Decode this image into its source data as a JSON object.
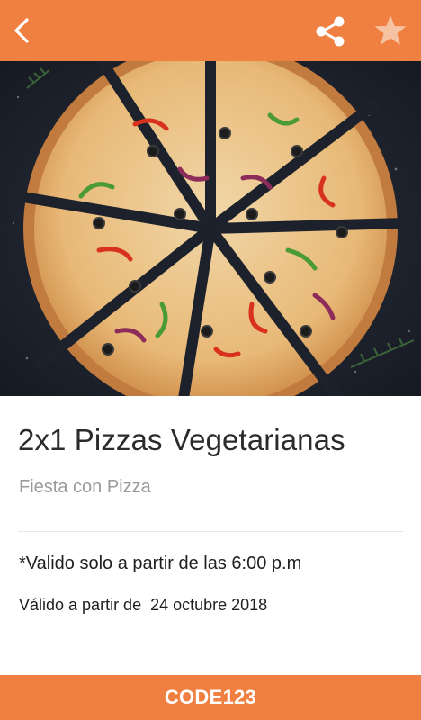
{
  "colors": {
    "accent": "#ef8041",
    "icon_white": "#ffffff",
    "star_muted": "#f6c2a1"
  },
  "icons": {
    "back": "chevron-left",
    "share": "share",
    "favorite": "star"
  },
  "hero_image": "pizza-photo",
  "offer": {
    "title": "2x1 Pizzas Vegetarianas",
    "merchant": "Fiesta con Pizza",
    "condition": "*Valido solo a partir de las 6:00 p.m",
    "validity": "Válido a partir de  24 octubre 2018"
  },
  "code": {
    "label": "CODE123"
  }
}
